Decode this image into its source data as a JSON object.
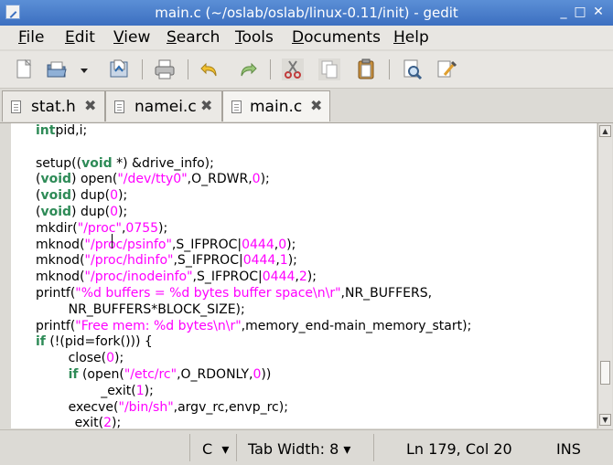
{
  "window": {
    "title": "main.c (~/oslab/oslab/linux-0.11/init) - gedit",
    "minimize": "_",
    "maximize": "□",
    "close": "✕"
  },
  "menu": [
    {
      "first": "F",
      "rest": "ile"
    },
    {
      "first": "E",
      "rest": "dit"
    },
    {
      "first": "V",
      "rest": "iew"
    },
    {
      "first": "S",
      "rest": "earch"
    },
    {
      "first": "T",
      "rest": "ools"
    },
    {
      "first": "D",
      "rest": "ocuments"
    },
    {
      "first": "H",
      "rest": "elp"
    }
  ],
  "toolbar": {
    "icons": [
      "new-document-icon",
      "open-icon",
      "open-dropdown-icon",
      "save-icon",
      "print-icon",
      "undo-icon",
      "redo-icon",
      "cut-icon",
      "copy-icon",
      "paste-icon",
      "find-icon",
      "replace-icon"
    ]
  },
  "tabs": [
    {
      "label": "stat.h",
      "close": "✖"
    },
    {
      "label": "namei.c",
      "close": "✖"
    },
    {
      "label": "main.c",
      "close": "✖"
    }
  ],
  "code": [
    [
      [
        "kw",
        "int"
      ],
      [
        "",
        "pid,i;"
      ]
    ],
    [],
    [
      [
        "",
        "setup(("
      ],
      [
        "kw",
        "void"
      ],
      [
        "",
        " *) &drive_info);"
      ]
    ],
    [
      [
        "",
        "("
      ],
      [
        "kw",
        "void"
      ],
      [
        "",
        ") open("
      ],
      [
        "str",
        "\"/dev/tty0\""
      ],
      [
        "",
        ",O_RDWR,"
      ],
      [
        "num",
        "0"
      ],
      [
        "",
        ");"
      ]
    ],
    [
      [
        "",
        "("
      ],
      [
        "kw",
        "void"
      ],
      [
        "",
        ") dup("
      ],
      [
        "num",
        "0"
      ],
      [
        "",
        ");"
      ]
    ],
    [
      [
        "",
        "("
      ],
      [
        "kw",
        "void"
      ],
      [
        "",
        ") dup("
      ],
      [
        "num",
        "0"
      ],
      [
        "",
        ");"
      ]
    ],
    [
      [
        "",
        "mkdir("
      ],
      [
        "str",
        "\"/proc\""
      ],
      [
        "",
        ","
      ],
      [
        "num",
        "0755"
      ],
      [
        "",
        ");"
      ]
    ],
    [
      [
        "",
        "mknod("
      ],
      [
        "str",
        "\"/proc/psinfo\""
      ],
      [
        "",
        ",S_IFPROC|"
      ],
      [
        "num",
        "0444"
      ],
      [
        "",
        ","
      ],
      [
        "num",
        "0"
      ],
      [
        "",
        ");"
      ]
    ],
    [
      [
        "",
        "mknod("
      ],
      [
        "str",
        "\"/proc/hdinfo\""
      ],
      [
        "",
        ",S_IFPROC|"
      ],
      [
        "num",
        "0444"
      ],
      [
        "",
        ","
      ],
      [
        "num",
        "1"
      ],
      [
        "",
        ");"
      ]
    ],
    [
      [
        "",
        "mknod("
      ],
      [
        "str",
        "\"/proc/inodeinfo\""
      ],
      [
        "",
        ",S_IFPROC|"
      ],
      [
        "num",
        "0444"
      ],
      [
        "",
        ","
      ],
      [
        "num",
        "2"
      ],
      [
        "",
        ");"
      ]
    ],
    [
      [
        "",
        "printf("
      ],
      [
        "str",
        "\"%d buffers = %d bytes buffer space\\n\\r\""
      ],
      [
        "",
        ",NR_BUFFERS,"
      ]
    ],
    [
      [
        "",
        "        NR_BUFFERS*BLOCK_SIZE);"
      ]
    ],
    [
      [
        "",
        "printf("
      ],
      [
        "str",
        "\"Free mem: %d bytes\\n\\r\""
      ],
      [
        "",
        ",memory_end-main_memory_start);"
      ]
    ],
    [
      [
        "kw",
        "if"
      ],
      [
        "",
        " (!(pid=fork())) {"
      ]
    ],
    [
      [
        "",
        "        close("
      ],
      [
        "num",
        "0"
      ],
      [
        "",
        ");"
      ]
    ],
    [
      [
        "",
        "        "
      ],
      [
        "kw",
        "if"
      ],
      [
        "",
        " (open("
      ],
      [
        "str",
        "\"/etc/rc\""
      ],
      [
        "",
        ",O_RDONLY,"
      ],
      [
        "num",
        "0"
      ],
      [
        "",
        "))"
      ]
    ],
    [
      [
        "",
        "                _exit("
      ],
      [
        "num",
        "1"
      ],
      [
        "",
        ");"
      ]
    ],
    [
      [
        "",
        "        execve("
      ],
      [
        "str",
        "\"/bin/sh\""
      ],
      [
        "",
        ",argv_rc,envp_rc);"
      ]
    ],
    [
      [
        "",
        "        _exit("
      ],
      [
        "num",
        "2"
      ],
      [
        "",
        ");"
      ]
    ],
    [
      [
        "",
        "}"
      ]
    ]
  ],
  "status": {
    "language": "C",
    "tab_width": "Tab Width:  8",
    "dropdown": "▾",
    "position": "Ln 179, Col 20",
    "mode": "INS"
  },
  "scrollbar": {
    "up": "▲",
    "down": "▼"
  }
}
